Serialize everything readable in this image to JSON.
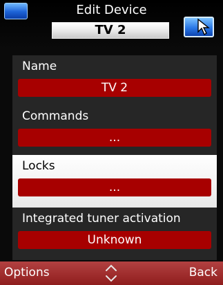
{
  "header": {
    "title": "Edit Device",
    "device_name": "TV 2",
    "left_icon": "tv-icon",
    "right_icon": "tv-icon",
    "cursor_icon": "pointer-icon"
  },
  "fields": [
    {
      "label": "Name",
      "value": "TV 2"
    },
    {
      "label": "Commands",
      "value": "..."
    },
    {
      "label": "Locks",
      "value": "..."
    },
    {
      "label": "Integrated tuner activation",
      "value": "Unknown"
    }
  ],
  "footer": {
    "left_label": "Options",
    "right_label": "Back",
    "scroll_icon": "up-down-chevron-icon"
  },
  "colors": {
    "accent_red": "#a70000",
    "footer_red": "#8f1d1d",
    "tv_blue": "#2a78e6",
    "selected_bg": "#ffffff",
    "panel_bg": "#262626"
  }
}
